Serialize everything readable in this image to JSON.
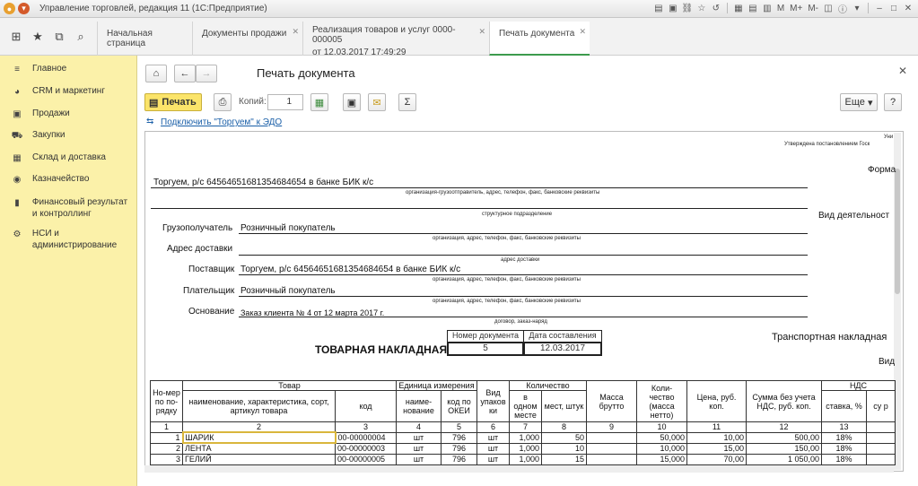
{
  "window": {
    "title": "Управление торговлей, редакция 11  (1С:Предприятие)",
    "m": "M",
    "mplus": "M+",
    "mminus": "M-"
  },
  "tabs": [
    {
      "label": "Начальная страница"
    },
    {
      "label": "Документы продажи"
    },
    {
      "label": "Реализация товаров и услуг 0000-000005",
      "sub": "от 12.03.2017 17:49:29"
    },
    {
      "label": "Печать документа"
    }
  ],
  "sidebar": {
    "items": [
      {
        "label": "Главное",
        "icon": "menu-icon"
      },
      {
        "label": "CRM и маркетинг",
        "icon": "crm-icon"
      },
      {
        "label": "Продажи",
        "icon": "sales-icon"
      },
      {
        "label": "Закупки",
        "icon": "purchases-icon"
      },
      {
        "label": "Склад и доставка",
        "icon": "warehouse-icon"
      },
      {
        "label": "Казначейство",
        "icon": "treasury-icon"
      },
      {
        "label": "Финансовый результат и контроллинг",
        "icon": "chart-icon"
      },
      {
        "label": "НСИ и администрирование",
        "icon": "settings-icon"
      }
    ]
  },
  "header": {
    "title": "Печать документа"
  },
  "toolbar": {
    "print": "Печать",
    "copies_label": "Копий:",
    "copies": "1",
    "more": "Еще",
    "help": "?",
    "sum": "Σ"
  },
  "edo_link": "Подключить \"Торгуем\" к ЭДО",
  "doc": {
    "top_right1": "Уни",
    "top_right2": "Утверждена постановлением Госк",
    "forma": "Форма",
    "sender": "Торгуем, р/с 64564651681354684654 в банке  БИК  к/с",
    "sender_caption": "организация-грузоотправитель, адрес, телефон, факс, банковские реквизиты",
    "struct_caption": "структурное подразделение",
    "activity": "Вид деятельност",
    "consignee_label": "Грузополучатель",
    "consignee": "Розничный покупатель",
    "org_caption": "организация, адрес, телефон, факс, банковские реквизиты",
    "address_label": "Адрес доставки",
    "address_caption": "адрес доставки",
    "supplier_label": "Поставщик",
    "supplier": "Торгуем, р/с 64564651681354684654 в банке  БИК  к/с",
    "payer_label": "Плательщик",
    "payer": "Розничный покупатель",
    "basis_label": "Основание",
    "basis": "Заказ клиента № 4 от 12 марта 2017 г.",
    "basis_caption": "договор, заказ-наряд",
    "docnum_h": "Номер документа",
    "docdate_h": "Дата составления",
    "docnum": "5",
    "docdate": "12.03.2017",
    "heading": "ТОВАРНАЯ НАКЛАДНАЯ",
    "transport": "Транспортная накладная",
    "vid": "Вид"
  },
  "table": {
    "h_num": "Но-мер по по-рядку",
    "h_goods": "Товар",
    "h_goods_name": "наименование, характеристика, сорт, артикул товара",
    "h_code": "код",
    "h_unit": "Единица измерения",
    "h_unit_name": "наиме-нование",
    "h_okei": "код по ОКЕИ",
    "h_pack": "Вид упаков ки",
    "h_qty": "Количество",
    "h_inplace": "в одном месте",
    "h_places": "мест, штук",
    "h_gross": "Масса брутто",
    "h_net": "Коли-чество (масса нетто)",
    "h_price": "Цена, руб. коп.",
    "h_sum": "Сумма без учета НДС, руб. коп.",
    "h_vat": "НДС",
    "h_rate": "ставка, %",
    "h_cut": "су р",
    "nums": [
      "1",
      "2",
      "3",
      "4",
      "5",
      "6",
      "7",
      "8",
      "9",
      "10",
      "11",
      "12",
      "13"
    ],
    "rows": [
      {
        "n": "1",
        "name": "ШАРИК",
        "code": "00-00000004",
        "unit": "шт",
        "okei": "796",
        "pack": "шт",
        "inplace": "1,000",
        "places": "50",
        "net": "50,000",
        "price": "10,00",
        "sum": "500,00",
        "rate": "18%"
      },
      {
        "n": "2",
        "name": "ЛЕНТА",
        "code": "00-00000003",
        "unit": "шт",
        "okei": "796",
        "pack": "шт",
        "inplace": "1,000",
        "places": "10",
        "net": "10,000",
        "price": "15,00",
        "sum": "150,00",
        "rate": "18%"
      },
      {
        "n": "3",
        "name": "ГЕЛИЙ",
        "code": "00-00000005",
        "unit": "шт",
        "okei": "796",
        "pack": "шт",
        "inplace": "1,000",
        "places": "15",
        "net": "15,000",
        "price": "70,00",
        "sum": "1 050,00",
        "rate": "18%"
      }
    ]
  }
}
